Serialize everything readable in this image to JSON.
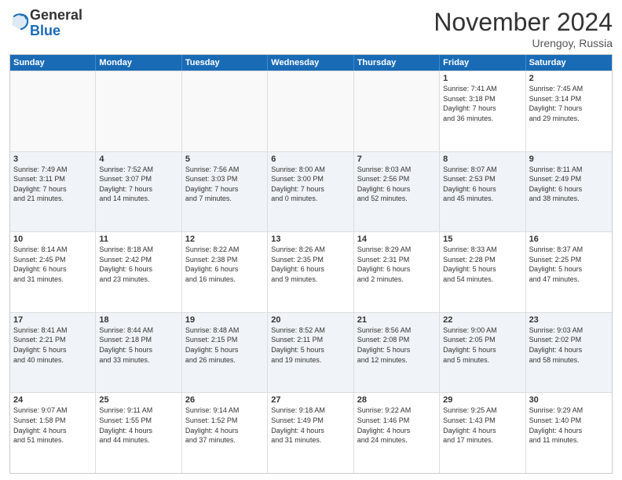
{
  "logo": {
    "general": "General",
    "blue": "Blue"
  },
  "title": "November 2024",
  "location": "Urengoy, Russia",
  "days_of_week": [
    "Sunday",
    "Monday",
    "Tuesday",
    "Wednesday",
    "Thursday",
    "Friday",
    "Saturday"
  ],
  "weeks": [
    [
      {
        "day": "",
        "info": ""
      },
      {
        "day": "",
        "info": ""
      },
      {
        "day": "",
        "info": ""
      },
      {
        "day": "",
        "info": ""
      },
      {
        "day": "",
        "info": ""
      },
      {
        "day": "1",
        "info": "Sunrise: 7:41 AM\nSunset: 3:18 PM\nDaylight: 7 hours\nand 36 minutes."
      },
      {
        "day": "2",
        "info": "Sunrise: 7:45 AM\nSunset: 3:14 PM\nDaylight: 7 hours\nand 29 minutes."
      }
    ],
    [
      {
        "day": "3",
        "info": "Sunrise: 7:49 AM\nSunset: 3:11 PM\nDaylight: 7 hours\nand 21 minutes."
      },
      {
        "day": "4",
        "info": "Sunrise: 7:52 AM\nSunset: 3:07 PM\nDaylight: 7 hours\nand 14 minutes."
      },
      {
        "day": "5",
        "info": "Sunrise: 7:56 AM\nSunset: 3:03 PM\nDaylight: 7 hours\nand 7 minutes."
      },
      {
        "day": "6",
        "info": "Sunrise: 8:00 AM\nSunset: 3:00 PM\nDaylight: 7 hours\nand 0 minutes."
      },
      {
        "day": "7",
        "info": "Sunrise: 8:03 AM\nSunset: 2:56 PM\nDaylight: 6 hours\nand 52 minutes."
      },
      {
        "day": "8",
        "info": "Sunrise: 8:07 AM\nSunset: 2:53 PM\nDaylight: 6 hours\nand 45 minutes."
      },
      {
        "day": "9",
        "info": "Sunrise: 8:11 AM\nSunset: 2:49 PM\nDaylight: 6 hours\nand 38 minutes."
      }
    ],
    [
      {
        "day": "10",
        "info": "Sunrise: 8:14 AM\nSunset: 2:45 PM\nDaylight: 6 hours\nand 31 minutes."
      },
      {
        "day": "11",
        "info": "Sunrise: 8:18 AM\nSunset: 2:42 PM\nDaylight: 6 hours\nand 23 minutes."
      },
      {
        "day": "12",
        "info": "Sunrise: 8:22 AM\nSunset: 2:38 PM\nDaylight: 6 hours\nand 16 minutes."
      },
      {
        "day": "13",
        "info": "Sunrise: 8:26 AM\nSunset: 2:35 PM\nDaylight: 6 hours\nand 9 minutes."
      },
      {
        "day": "14",
        "info": "Sunrise: 8:29 AM\nSunset: 2:31 PM\nDaylight: 6 hours\nand 2 minutes."
      },
      {
        "day": "15",
        "info": "Sunrise: 8:33 AM\nSunset: 2:28 PM\nDaylight: 5 hours\nand 54 minutes."
      },
      {
        "day": "16",
        "info": "Sunrise: 8:37 AM\nSunset: 2:25 PM\nDaylight: 5 hours\nand 47 minutes."
      }
    ],
    [
      {
        "day": "17",
        "info": "Sunrise: 8:41 AM\nSunset: 2:21 PM\nDaylight: 5 hours\nand 40 minutes."
      },
      {
        "day": "18",
        "info": "Sunrise: 8:44 AM\nSunset: 2:18 PM\nDaylight: 5 hours\nand 33 minutes."
      },
      {
        "day": "19",
        "info": "Sunrise: 8:48 AM\nSunset: 2:15 PM\nDaylight: 5 hours\nand 26 minutes."
      },
      {
        "day": "20",
        "info": "Sunrise: 8:52 AM\nSunset: 2:11 PM\nDaylight: 5 hours\nand 19 minutes."
      },
      {
        "day": "21",
        "info": "Sunrise: 8:56 AM\nSunset: 2:08 PM\nDaylight: 5 hours\nand 12 minutes."
      },
      {
        "day": "22",
        "info": "Sunrise: 9:00 AM\nSunset: 2:05 PM\nDaylight: 5 hours\nand 5 minutes."
      },
      {
        "day": "23",
        "info": "Sunrise: 9:03 AM\nSunset: 2:02 PM\nDaylight: 4 hours\nand 58 minutes."
      }
    ],
    [
      {
        "day": "24",
        "info": "Sunrise: 9:07 AM\nSunset: 1:58 PM\nDaylight: 4 hours\nand 51 minutes."
      },
      {
        "day": "25",
        "info": "Sunrise: 9:11 AM\nSunset: 1:55 PM\nDaylight: 4 hours\nand 44 minutes."
      },
      {
        "day": "26",
        "info": "Sunrise: 9:14 AM\nSunset: 1:52 PM\nDaylight: 4 hours\nand 37 minutes."
      },
      {
        "day": "27",
        "info": "Sunrise: 9:18 AM\nSunset: 1:49 PM\nDaylight: 4 hours\nand 31 minutes."
      },
      {
        "day": "28",
        "info": "Sunrise: 9:22 AM\nSunset: 1:46 PM\nDaylight: 4 hours\nand 24 minutes."
      },
      {
        "day": "29",
        "info": "Sunrise: 9:25 AM\nSunset: 1:43 PM\nDaylight: 4 hours\nand 17 minutes."
      },
      {
        "day": "30",
        "info": "Sunrise: 9:29 AM\nSunset: 1:40 PM\nDaylight: 4 hours\nand 11 minutes."
      }
    ]
  ]
}
